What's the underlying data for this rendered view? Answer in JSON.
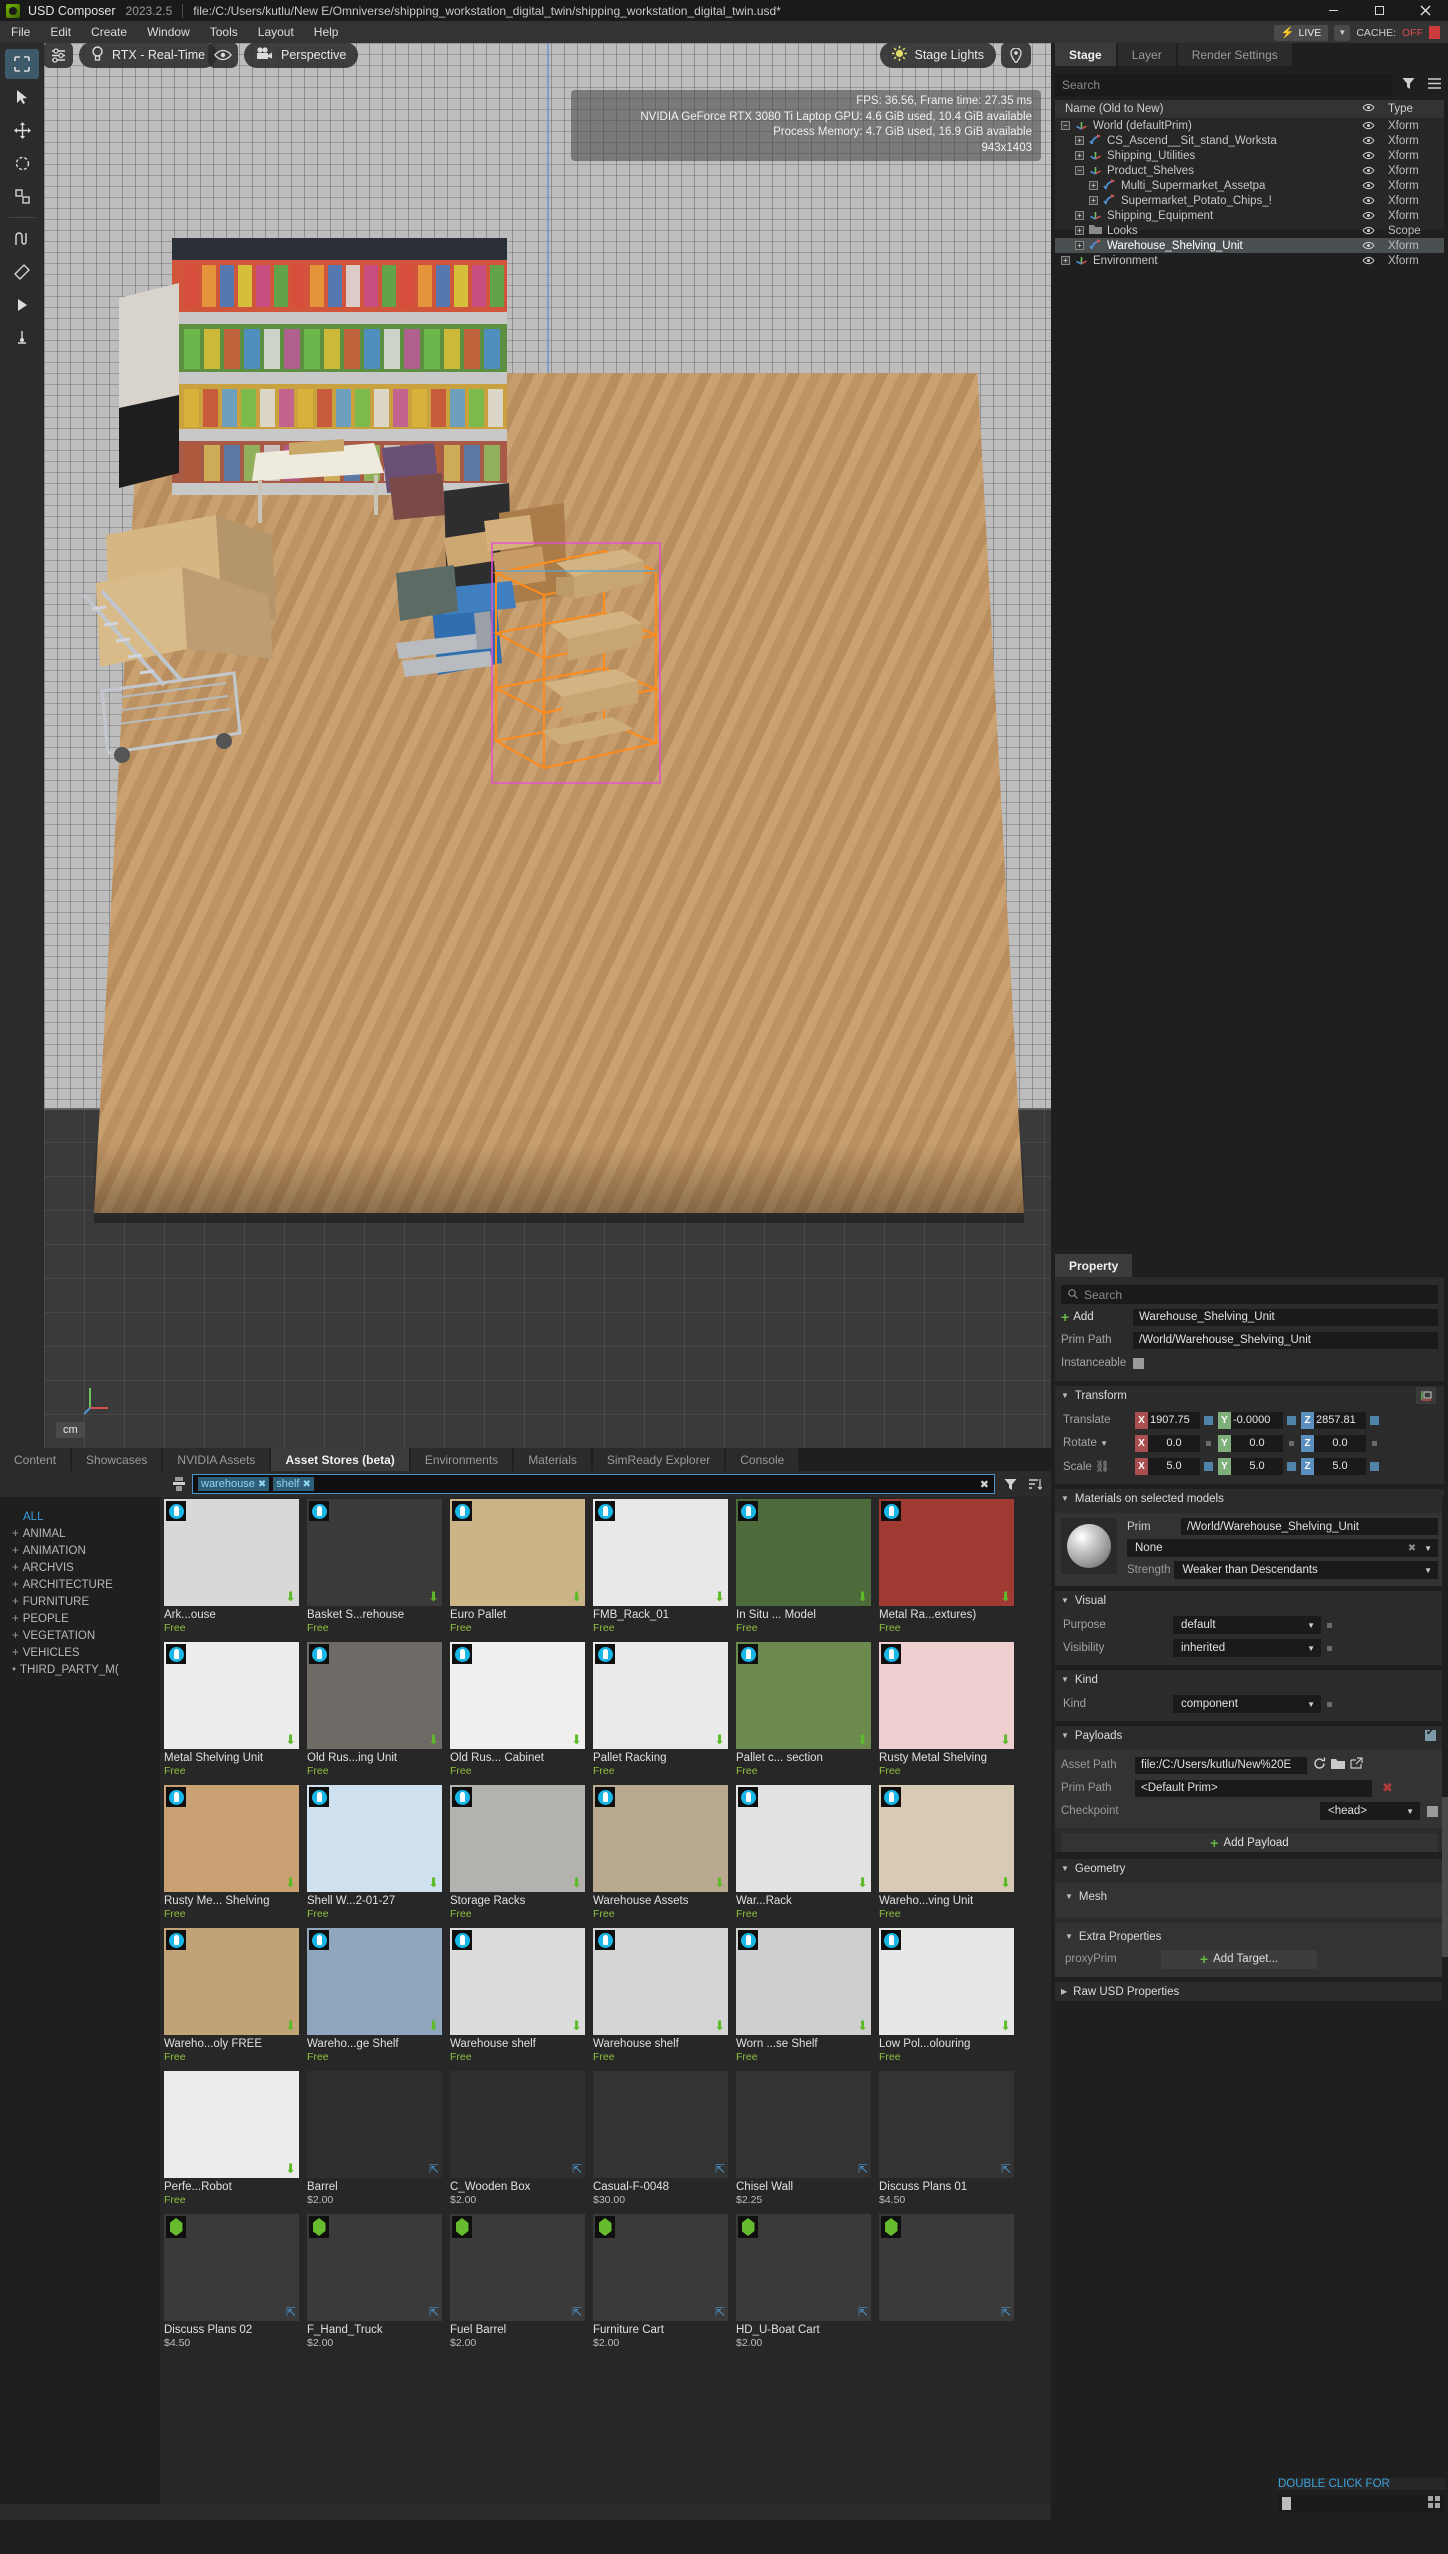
{
  "titlebar": {
    "app_name": "USD Composer",
    "version": "2023.2.5",
    "file_path": "file:/C:/Users/kutlu/New E/Omniverse/shipping_workstation_digital_twin/shipping_workstation_digital_twin.usd*",
    "live_label": "LIVE",
    "cache_label": "CACHE:",
    "cache_value": "OFF",
    "accent_green": "#76b900",
    "cache_off_color": "#e04b4b"
  },
  "menubar": {
    "items": [
      "File",
      "Edit",
      "Create",
      "Window",
      "Tools",
      "Layout",
      "Help"
    ]
  },
  "left_toolbar": {
    "tools": [
      {
        "name": "select-tool"
      },
      {
        "name": "cursor-tool"
      },
      {
        "name": "move-tool"
      },
      {
        "name": "rotate-tool"
      },
      {
        "name": "scale-tool"
      },
      {
        "name": "snap-tool"
      },
      {
        "name": "measure-tool"
      },
      {
        "name": "play-tool"
      },
      {
        "name": "physics-tool"
      }
    ]
  },
  "viewport": {
    "render_mode": "RTX - Real-Time",
    "camera": "Perspective",
    "lighting": "Stage Lights",
    "stats": {
      "fps_line": "FPS: 36.56, Frame time: 27.35 ms",
      "gpu_line": "NVIDIA GeForce RTX 3080 Ti Laptop GPU: 4.6 GiB used, 10.4 GiB available",
      "memory_line": "Process Memory: 4.7 GiB used, 16.9 GiB available",
      "resolution_line": "943x1403"
    },
    "units": "cm"
  },
  "stage": {
    "tabs": [
      {
        "label": "Stage",
        "active": true
      },
      {
        "label": "Layer",
        "active": false
      },
      {
        "label": "Render Settings",
        "active": false
      }
    ],
    "search_placeholder": "Search",
    "columns": {
      "name": "Name (Old to New)",
      "type": "Type"
    },
    "rows": [
      {
        "label": "World (defaultPrim)",
        "type": "Xform",
        "depth": 0,
        "expander": "minus",
        "icon": "xform-axis-icon",
        "selected": false
      },
      {
        "label": "CS_Ascend__Sit_stand_Worksta",
        "type": "Xform",
        "depth": 1,
        "expander": "plus",
        "icon": "reference-xform-icon",
        "selected": false
      },
      {
        "label": "Shipping_Utilities",
        "type": "Xform",
        "depth": 1,
        "expander": "plus",
        "icon": "xform-axis-icon",
        "selected": false
      },
      {
        "label": "Product_Shelves",
        "type": "Xform",
        "depth": 1,
        "expander": "minus",
        "icon": "xform-axis-icon",
        "selected": false
      },
      {
        "label": "Multi_Supermarket_Assetpa",
        "type": "Xform",
        "depth": 2,
        "expander": "plus",
        "icon": "reference-xform-icon",
        "selected": false
      },
      {
        "label": "Supermarket_Potato_Chips_!",
        "type": "Xform",
        "depth": 2,
        "expander": "plus",
        "icon": "reference-xform-icon",
        "selected": false
      },
      {
        "label": "Shipping_Equipment",
        "type": "Xform",
        "depth": 1,
        "expander": "plus",
        "icon": "xform-axis-icon",
        "selected": false
      },
      {
        "label": "Looks",
        "type": "Scope",
        "depth": 1,
        "expander": "plus",
        "icon": "folder-icon",
        "selected": false
      },
      {
        "label": "Warehouse_Shelving_Unit",
        "type": "Xform",
        "depth": 1,
        "expander": "plus",
        "icon": "reference-xform-icon",
        "selected": true
      },
      {
        "label": "Environment",
        "type": "Xform",
        "depth": 0,
        "expander": "plus",
        "icon": "xform-axis-icon",
        "selected": false
      }
    ]
  },
  "property": {
    "tab_label": "Property",
    "search_placeholder": "Search",
    "add_label": "Add",
    "prim_name": "Warehouse_Shelving_Unit",
    "prim_path_label": "Prim Path",
    "prim_path_value": "/World/Warehouse_Shelving_Unit",
    "instanceable_label": "Instanceable",
    "transform": {
      "title": "Transform",
      "translate_label": "Translate",
      "rotate_label": "Rotate",
      "scale_label": "Scale",
      "translate": {
        "x": "1907.75",
        "y": "-0.0000",
        "z": "2857.81"
      },
      "rotate": {
        "x": "0.0",
        "y": "0.0",
        "z": "0.0"
      },
      "scale": {
        "x": "5.0",
        "y": "5.0",
        "z": "5.0"
      }
    },
    "materials": {
      "title": "Materials on selected models",
      "prim_label": "Prim",
      "prim_value": "/World/Warehouse_Shelving_Unit",
      "material_value": "None",
      "strength_label": "Strength",
      "strength_value": "Weaker than Descendants"
    },
    "visual": {
      "title": "Visual",
      "purpose_label": "Purpose",
      "purpose_value": "default",
      "visibility_label": "Visibility",
      "visibility_value": "inherited"
    },
    "kind": {
      "title": "Kind",
      "kind_label": "Kind",
      "kind_value": "component"
    },
    "payloads": {
      "title": "Payloads",
      "asset_path_label": "Asset Path",
      "asset_path_value": "file:/C:/Users/kutlu/New%20E",
      "prim_path_label": "Prim Path",
      "prim_path_value": "<Default Prim>",
      "checkpoint_label": "Checkpoint",
      "checkpoint_value": "<head>",
      "add_payload_label": "Add Payload"
    },
    "geometry": {
      "title": "Geometry",
      "mesh_title": "Mesh",
      "extra_title": "Extra Properties",
      "proxy_prim_label": "proxyPrim",
      "add_target_label": "Add Target..."
    },
    "raw_usd": "Raw USD Properties"
  },
  "browser": {
    "tabs": [
      {
        "label": "Content",
        "active": false
      },
      {
        "label": "Showcases",
        "active": false
      },
      {
        "label": "NVIDIA Assets",
        "active": false
      },
      {
        "label": "Asset Stores (beta)",
        "active": true
      },
      {
        "label": "Environments",
        "active": false
      },
      {
        "label": "Materials",
        "active": false
      },
      {
        "label": "SimReady Explorer",
        "active": false
      },
      {
        "label": "Console",
        "active": false
      }
    ],
    "search_tags": [
      "warehouse",
      "shelf"
    ],
    "categories": [
      {
        "label": "ALL",
        "prefix": "",
        "all": true
      },
      {
        "label": "ANIMAL",
        "prefix": "+"
      },
      {
        "label": "ANIMATION",
        "prefix": "+"
      },
      {
        "label": "ARCHVIS",
        "prefix": "+"
      },
      {
        "label": "ARCHITECTURE",
        "prefix": "+"
      },
      {
        "label": "FURNITURE",
        "prefix": "+"
      },
      {
        "label": "PEOPLE",
        "prefix": "+"
      },
      {
        "label": "VEGETATION",
        "prefix": "+"
      },
      {
        "label": "VEHICLES",
        "prefix": "+"
      },
      {
        "label": "THIRD_PARTY_M(",
        "prefix": "•"
      }
    ],
    "double_click_hint": "DOUBLE CLICK FOR",
    "assets": [
      {
        "name": "Ark...ouse",
        "price": "Free",
        "free": true,
        "badge": "nvidia",
        "action": "download",
        "thumb": "#d8d8d8"
      },
      {
        "name": "Basket S...rehouse",
        "price": "Free",
        "free": true,
        "badge": "nvidia",
        "action": "download",
        "thumb": "#3a3a38"
      },
      {
        "name": "Euro Pallet",
        "price": "Free",
        "free": true,
        "badge": "nvidia",
        "action": "download",
        "thumb": "#cbb487"
      },
      {
        "name": "FMB_Rack_01",
        "price": "Free",
        "free": true,
        "badge": "nvidia",
        "action": "download",
        "thumb": "#e8e8e8"
      },
      {
        "name": "In Situ ... Model",
        "price": "Free",
        "free": true,
        "badge": "nvidia",
        "action": "download",
        "thumb": "#4d6b3a"
      },
      {
        "name": "Metal Ra...extures)",
        "price": "Free",
        "free": true,
        "badge": "nvidia",
        "action": "download",
        "thumb": "#a03a33"
      },
      {
        "name": "Metal Shelving Unit",
        "price": "Free",
        "free": true,
        "badge": "nvidia",
        "action": "download",
        "thumb": "#ededed"
      },
      {
        "name": "Old Rus...ing Unit",
        "price": "Free",
        "free": true,
        "badge": "nvidia",
        "action": "download",
        "thumb": "#6e6a66"
      },
      {
        "name": "Old Rus... Cabinet",
        "price": "Free",
        "free": true,
        "badge": "nvidia",
        "action": "download",
        "thumb": "#f0efed"
      },
      {
        "name": "Pallet Racking",
        "price": "Free",
        "free": true,
        "badge": "nvidia",
        "action": "download",
        "thumb": "#eaeaea"
      },
      {
        "name": "Pallet c... section",
        "price": "Free",
        "free": true,
        "badge": "nvidia",
        "action": "download",
        "thumb": "#6d8a4e"
      },
      {
        "name": "Rusty Metal Shelving",
        "price": "Free",
        "free": true,
        "badge": "nvidia",
        "action": "download",
        "thumb": "#f0cfd0"
      },
      {
        "name": "Rusty Me... Shelving",
        "price": "Free",
        "free": true,
        "badge": "nvidia",
        "action": "download",
        "thumb": "#c9a173"
      },
      {
        "name": "Shell W...2-01-27",
        "price": "Free",
        "free": true,
        "badge": "nvidia",
        "action": "download",
        "thumb": "#cfe0ee"
      },
      {
        "name": "Storage Racks",
        "price": "Free",
        "free": true,
        "badge": "nvidia",
        "action": "download",
        "thumb": "#b3b2ae"
      },
      {
        "name": "Warehouse Assets",
        "price": "Free",
        "free": true,
        "badge": "nvidia",
        "action": "download",
        "thumb": "#b9a98f"
      },
      {
        "name": "War...Rack",
        "price": "Free",
        "free": true,
        "badge": "nvidia",
        "action": "download",
        "thumb": "#e2e2e2"
      },
      {
        "name": "Wareho...ving Unit",
        "price": "Free",
        "free": true,
        "badge": "nvidia",
        "action": "download",
        "thumb": "#d8cbb5"
      },
      {
        "name": "Wareho...oly FREE",
        "price": "Free",
        "free": true,
        "badge": "nvidia",
        "action": "download",
        "thumb": "#c2a378"
      },
      {
        "name": "Wareho...ge Shelf",
        "price": "Free",
        "free": true,
        "badge": "nvidia",
        "action": "download",
        "thumb": "#8fa6bd"
      },
      {
        "name": "Warehouse shelf",
        "price": "Free",
        "free": true,
        "badge": "nvidia",
        "action": "download",
        "thumb": "#dcdcdc"
      },
      {
        "name": "Warehouse shelf",
        "price": "Free",
        "free": true,
        "badge": "nvidia",
        "action": "download",
        "thumb": "#d5d5d5"
      },
      {
        "name": "Worn ...se Shelf",
        "price": "Free",
        "free": true,
        "badge": "nvidia",
        "action": "download",
        "thumb": "#cfcfcf"
      },
      {
        "name": "Low Pol...olouring",
        "price": "Free",
        "free": true,
        "badge": "nvidia",
        "action": "download",
        "thumb": "#e7e7e7"
      },
      {
        "name": "Perfe...Robot",
        "price": "Free",
        "free": true,
        "badge": "",
        "action": "download",
        "thumb": "#ececec"
      },
      {
        "name": "Barrel",
        "price": "$2.00",
        "free": false,
        "badge": "",
        "action": "external",
        "thumb": "#2f2f2f"
      },
      {
        "name": "C_Wooden Box",
        "price": "$2.00",
        "free": false,
        "badge": "",
        "action": "external",
        "thumb": "#2f2f2f"
      },
      {
        "name": "Casual-F-0048",
        "price": "$30.00",
        "free": false,
        "badge": "",
        "action": "external",
        "thumb": "#333333"
      },
      {
        "name": "Chisel Wall",
        "price": "$2.25",
        "free": false,
        "badge": "",
        "action": "external",
        "thumb": "#333333"
      },
      {
        "name": "Discuss Plans 01",
        "price": "$4.50",
        "free": false,
        "badge": "",
        "action": "external",
        "thumb": "#333333"
      },
      {
        "name": "Discuss Plans 02",
        "price": "$4.50",
        "free": false,
        "badge": "sketchfab",
        "action": "external",
        "thumb": "#3a3a3a"
      },
      {
        "name": "F_Hand_Truck",
        "price": "$2.00",
        "free": false,
        "badge": "sketchfab",
        "action": "external",
        "thumb": "#3a3a3a"
      },
      {
        "name": "Fuel Barrel",
        "price": "$2.00",
        "free": false,
        "badge": "sketchfab",
        "action": "external",
        "thumb": "#3a3a3a"
      },
      {
        "name": "Furniture Cart",
        "price": "$2.00",
        "free": false,
        "badge": "sketchfab",
        "action": "external",
        "thumb": "#3a3a3a"
      },
      {
        "name": "HD_U-Boat Cart",
        "price": "$2.00",
        "free": false,
        "badge": "sketchfab",
        "action": "external",
        "thumb": "#3a3a3a"
      },
      {
        "name": "",
        "price": "",
        "free": false,
        "badge": "sketchfab",
        "action": "external",
        "thumb": "#3a3a3a"
      }
    ]
  }
}
